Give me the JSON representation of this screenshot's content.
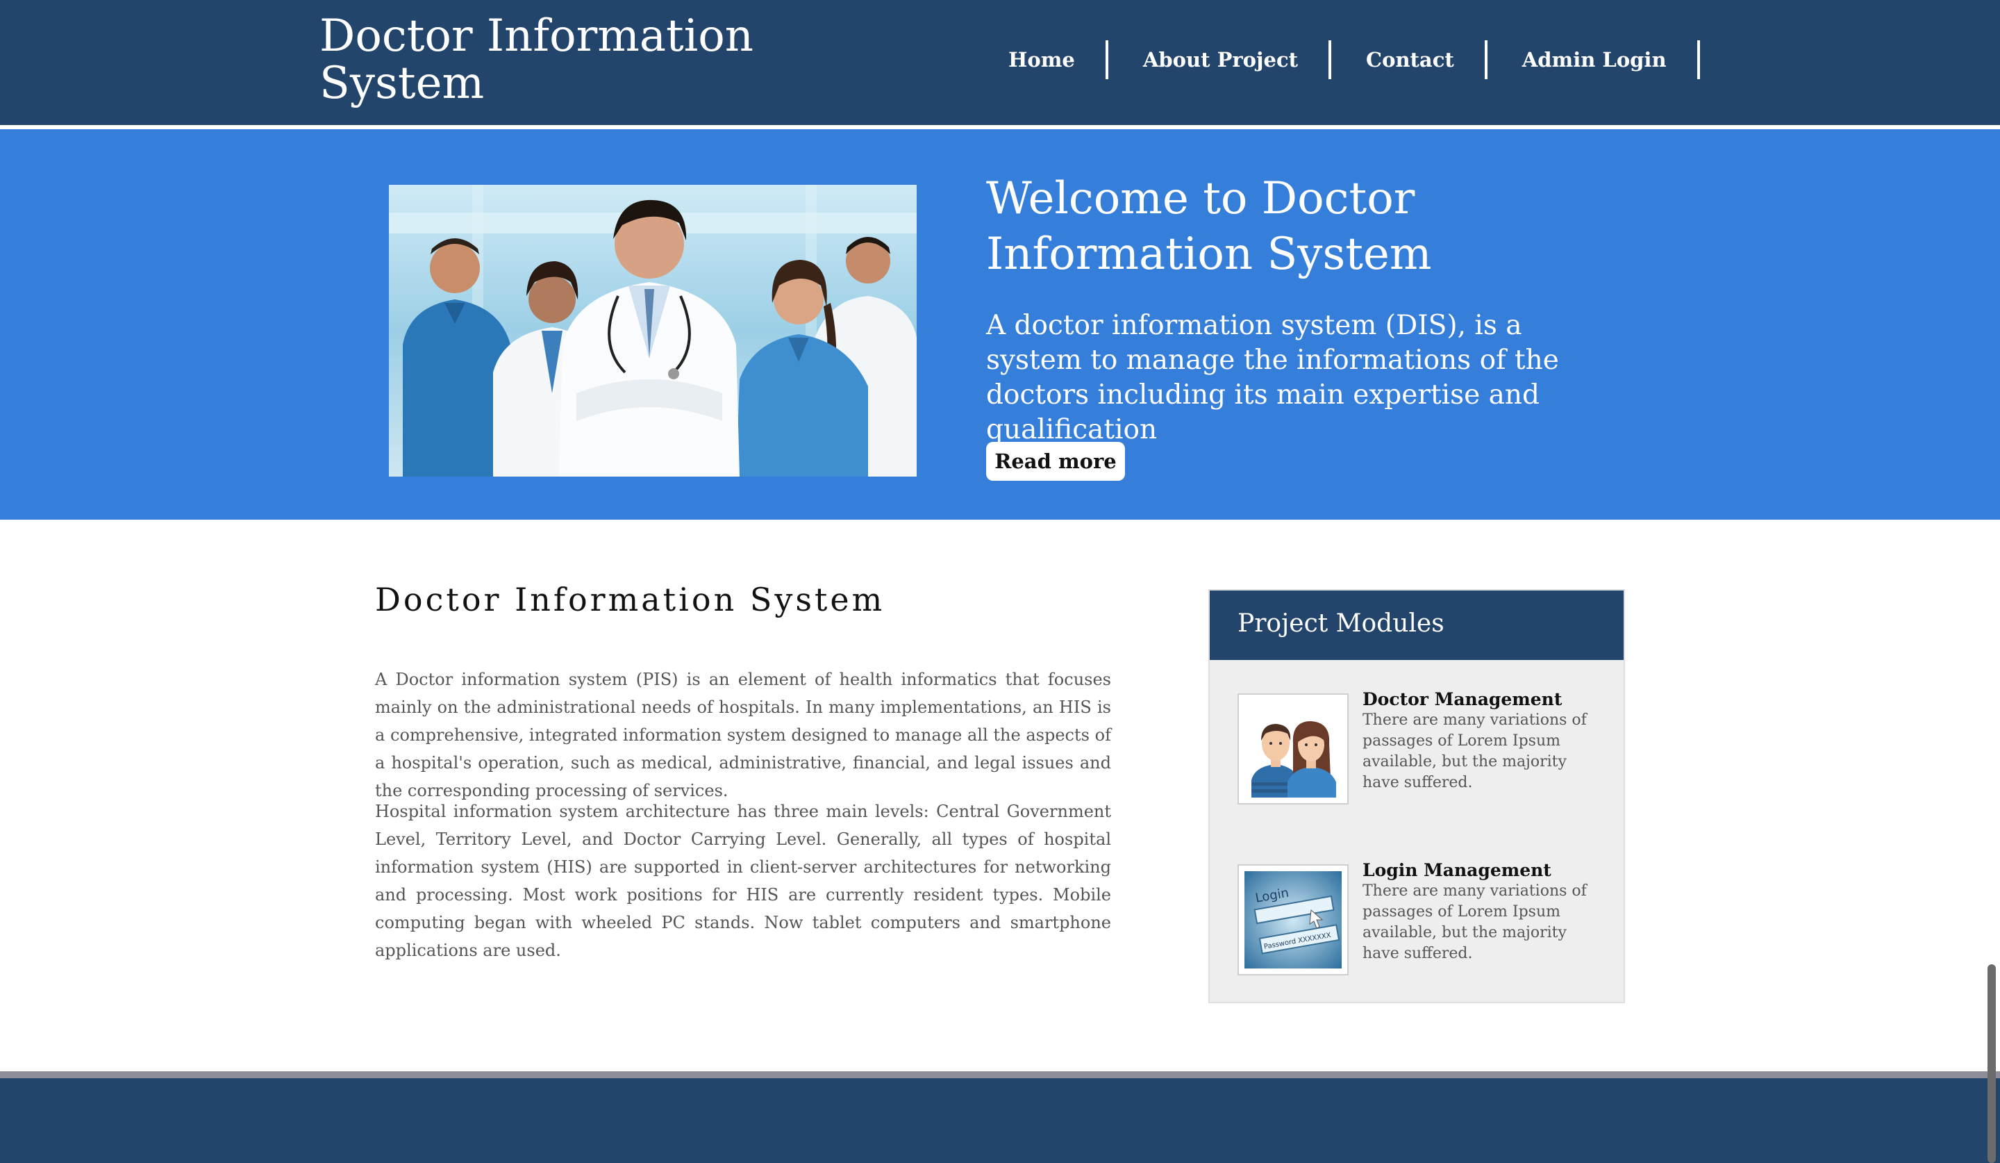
{
  "header": {
    "site_title": "Doctor Information System",
    "nav": [
      {
        "label": "Home"
      },
      {
        "label": "About Project"
      },
      {
        "label": "Contact"
      },
      {
        "label": "Admin Login"
      }
    ]
  },
  "hero": {
    "title": "Welcome to Doctor Information System",
    "text": "A doctor information system (DIS), is a system to manage the informations of the doctors including its main expertise and qualification",
    "button_label": "Read more"
  },
  "main": {
    "heading": "Doctor Information System",
    "paragraphs": [
      "A Doctor information system (PIS) is an element of health informatics that focuses mainly on the administrational needs of hospitals. In many implementations, an HIS is a comprehensive, integrated information system designed to manage all the aspects of a hospital's operation, such as medical, administrative, financial, and legal issues and the corresponding processing of services.",
      "Hospital information system architecture has three main levels: Central Government Level, Territory Level, and Doctor Carrying Level. Generally, all types of hospital information system (HIS) are supported in client-server architectures for networking and processing. Most work positions for HIS are currently resident types. Mobile computing began with wheeled PC stands. Now tablet computers and smartphone applications are used."
    ]
  },
  "modules": {
    "title": "Project Modules",
    "items": [
      {
        "title": "Doctor Management",
        "description": "There are many variations of passages of Lorem Ipsum available, but the majority have suffered."
      },
      {
        "title": "Login Management",
        "description": "There are many variations of passages of Lorem Ipsum available, but the majority have suffered.",
        "image_text": {
          "login": "Login",
          "password": "Password XXXXXXX"
        }
      }
    ]
  },
  "colors": {
    "header_bg": "#23446b",
    "hero_bg": "#357fda",
    "panel_bg": "#eeeeee",
    "footer_bg": "#23446b"
  }
}
